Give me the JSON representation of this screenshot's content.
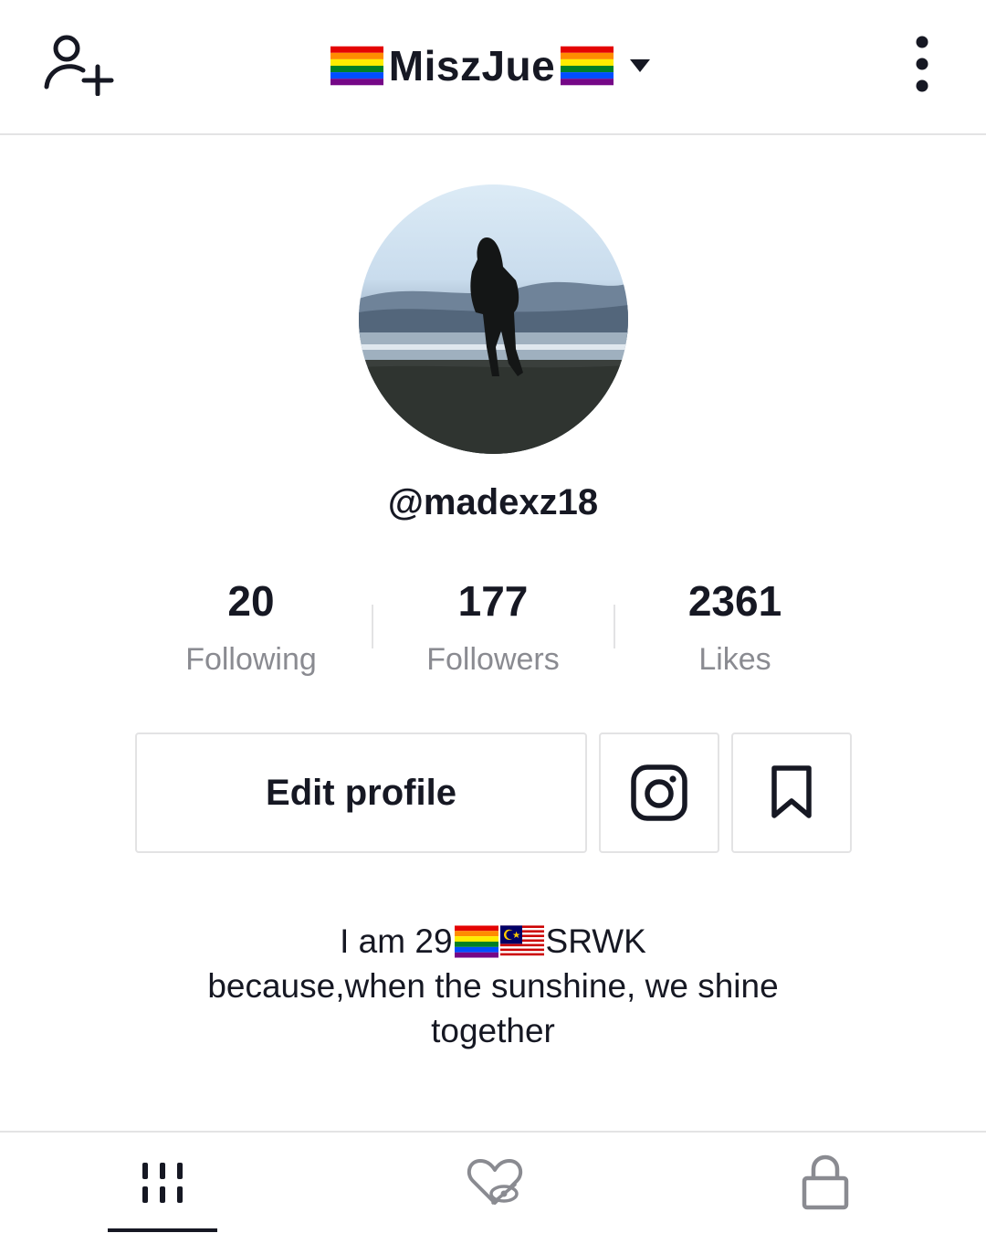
{
  "header": {
    "title": "MiszJue",
    "add_user_icon": "add-user-icon",
    "dropdown_icon": "caret-down-icon",
    "more_icon": "more-vertical-icon",
    "flag": "rainbow-flag"
  },
  "profile": {
    "username": "@madexz18",
    "avatar": "beach-silhouette-photo"
  },
  "stats": [
    {
      "value": "20",
      "label": "Following"
    },
    {
      "value": "177",
      "label": "Followers"
    },
    {
      "value": "2361",
      "label": "Likes"
    }
  ],
  "actions": {
    "edit_label": "Edit profile",
    "instagram_icon": "instagram-icon",
    "bookmark_icon": "bookmark-icon"
  },
  "bio": {
    "line1_prefix": "I am 29",
    "line1_suffix": "SRWK",
    "line2": "because,when the sunshine, we shine",
    "line3": "together",
    "flags": [
      "rainbow-flag",
      "malaysia-flag"
    ]
  },
  "tabs": [
    {
      "icon": "grid-icon",
      "active": true
    },
    {
      "icon": "liked-hidden-icon",
      "active": false
    },
    {
      "icon": "lock-icon",
      "active": false
    }
  ],
  "colors": {
    "text": "#161823",
    "muted": "#8a8b91",
    "border": "#e3e3e4"
  }
}
